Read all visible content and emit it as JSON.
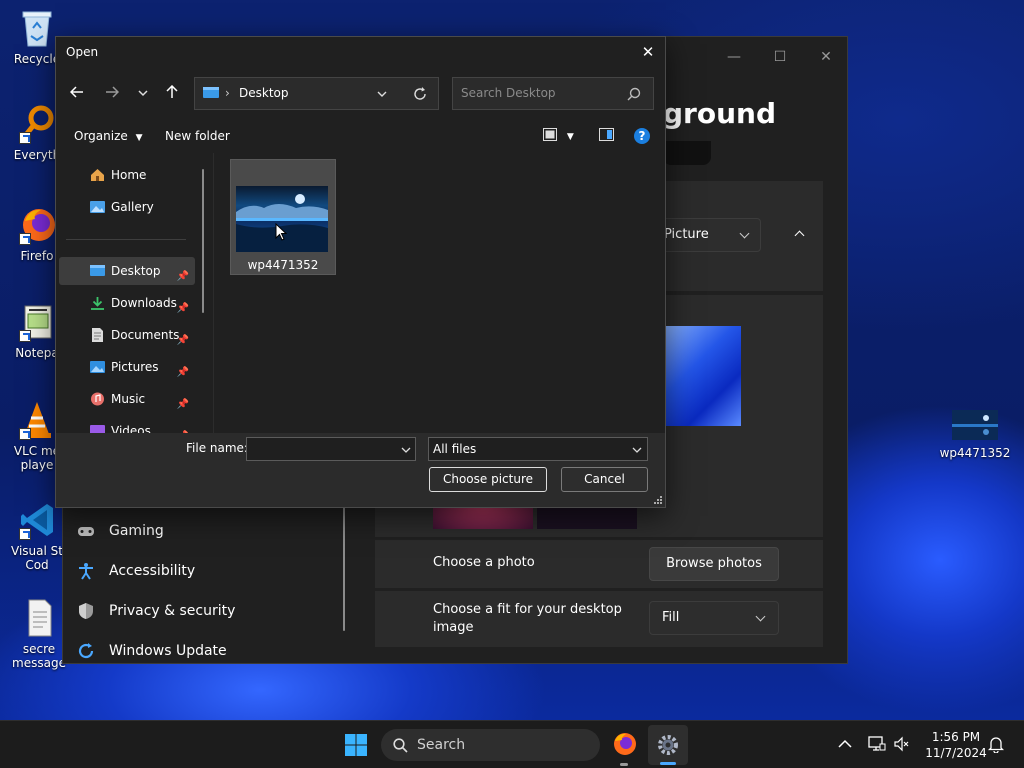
{
  "desktop": {
    "icons": [
      {
        "label": "Recycle"
      },
      {
        "label": "Everyth"
      },
      {
        "label": "Firefo"
      },
      {
        "label": "Notepa"
      },
      {
        "label": "VLC me\nplaye"
      },
      {
        "label": "Visual St\nCod"
      },
      {
        "label": "secre\nmessage"
      },
      {
        "label": "wp4471352"
      }
    ]
  },
  "settings": {
    "title_fragment": "ground",
    "background_select": "Picture",
    "nav": [
      {
        "label": "Gaming",
        "icon": "gamepad-icon"
      },
      {
        "label": "Accessibility",
        "icon": "accessibility-icon"
      },
      {
        "label": "Privacy & security",
        "icon": "shield-icon"
      },
      {
        "label": "Windows Update",
        "icon": "update-icon"
      }
    ],
    "choose_photo_label": "Choose a photo",
    "browse_photos": "Browse photos",
    "choose_fit_label": "Choose a fit for your desktop image",
    "fit_value": "Fill"
  },
  "dialog": {
    "title": "Open",
    "address": "Desktop",
    "search_placeholder": "Search Desktop",
    "organize": "Organize",
    "new_folder": "New folder",
    "sidebar": [
      {
        "label": "Home",
        "icon": "home-icon"
      },
      {
        "label": "Gallery",
        "icon": "gallery-icon"
      },
      {
        "label": "Desktop",
        "icon": "desktop-folder-icon",
        "pinned": true
      },
      {
        "label": "Downloads",
        "icon": "download-icon",
        "pinned": true
      },
      {
        "label": "Documents",
        "icon": "documents-icon",
        "pinned": true
      },
      {
        "label": "Pictures",
        "icon": "pictures-icon",
        "pinned": true
      },
      {
        "label": "Music",
        "icon": "music-icon",
        "pinned": true
      },
      {
        "label": "Videos",
        "icon": "videos-icon",
        "pinned": true
      }
    ],
    "files": [
      {
        "name": "wp4471352"
      }
    ],
    "file_name_label": "File name:",
    "file_name_value": "",
    "file_type": "All files",
    "choose_button": "Choose picture",
    "cancel_button": "Cancel"
  },
  "taskbar": {
    "search_label": "Search",
    "time": "1:56 PM",
    "date": "11/7/2024"
  },
  "colors": {
    "accent": "#0078d4",
    "window_bg": "#202020",
    "footer_bg": "#2b2b2b"
  }
}
